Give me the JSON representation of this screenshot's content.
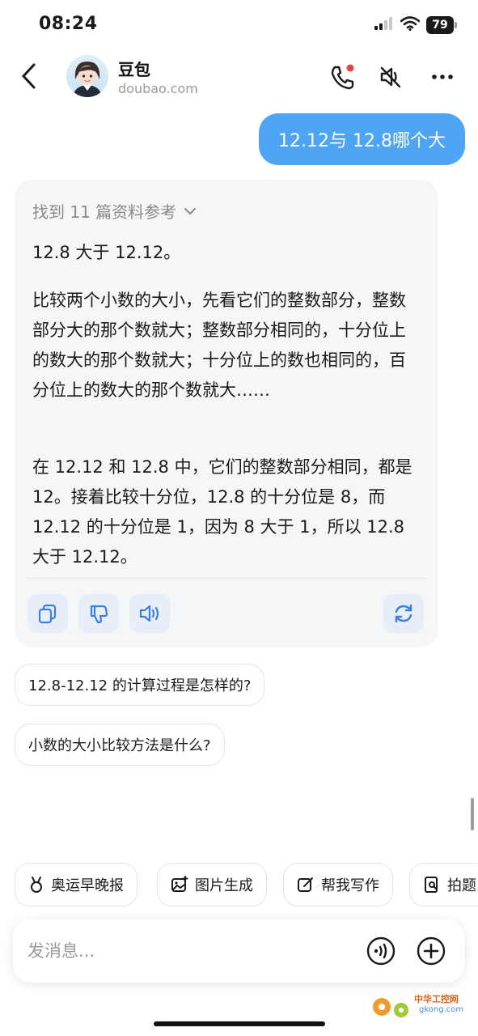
{
  "status_bar": {
    "time": "08:24",
    "battery": "79"
  },
  "header": {
    "name": "豆包",
    "subtitle": "doubao.com"
  },
  "user_message": "12.12与 12.8哪个大",
  "answer": {
    "references": "找到 11 篇资料参考",
    "paragraph_1": "12.8 大于 12.12。",
    "paragraph_2": "比较两个小数的大小，先看它们的整数部分，整数部分大的那个数就大；整数部分相同的，十分位上的数大的那个数就大；十分位上的数也相同的，百分位上的数大的那个数就大……",
    "paragraph_3": "在 12.12 和 12.8 中，它们的整数部分相同，都是 12。接着比较十分位，12.8 的十分位是 8，而 12.12 的十分位是 1，因为 8 大于 1，所以 12.8 大于 12.12。"
  },
  "suggestions": [
    "12.8-12.12 的计算过程是怎样的?",
    "小数的大小比较方法是什么?"
  ],
  "quick_actions": [
    {
      "label": "奥运早晚报",
      "icon": "medal-icon"
    },
    {
      "label": "图片生成",
      "icon": "image-add-icon"
    },
    {
      "label": "帮我写作",
      "icon": "edit-icon"
    },
    {
      "label": "拍题",
      "icon": "search-doc-icon"
    }
  ],
  "input": {
    "placeholder": "发消息..."
  },
  "watermark": {
    "text": "中华工控网",
    "sub": "gkong.com"
  },
  "colors": {
    "accent": "#4ea5f5",
    "action_icon": "#3b7fe0",
    "card_bg": "#f5f6f7",
    "notification_dot": "#f04040"
  }
}
